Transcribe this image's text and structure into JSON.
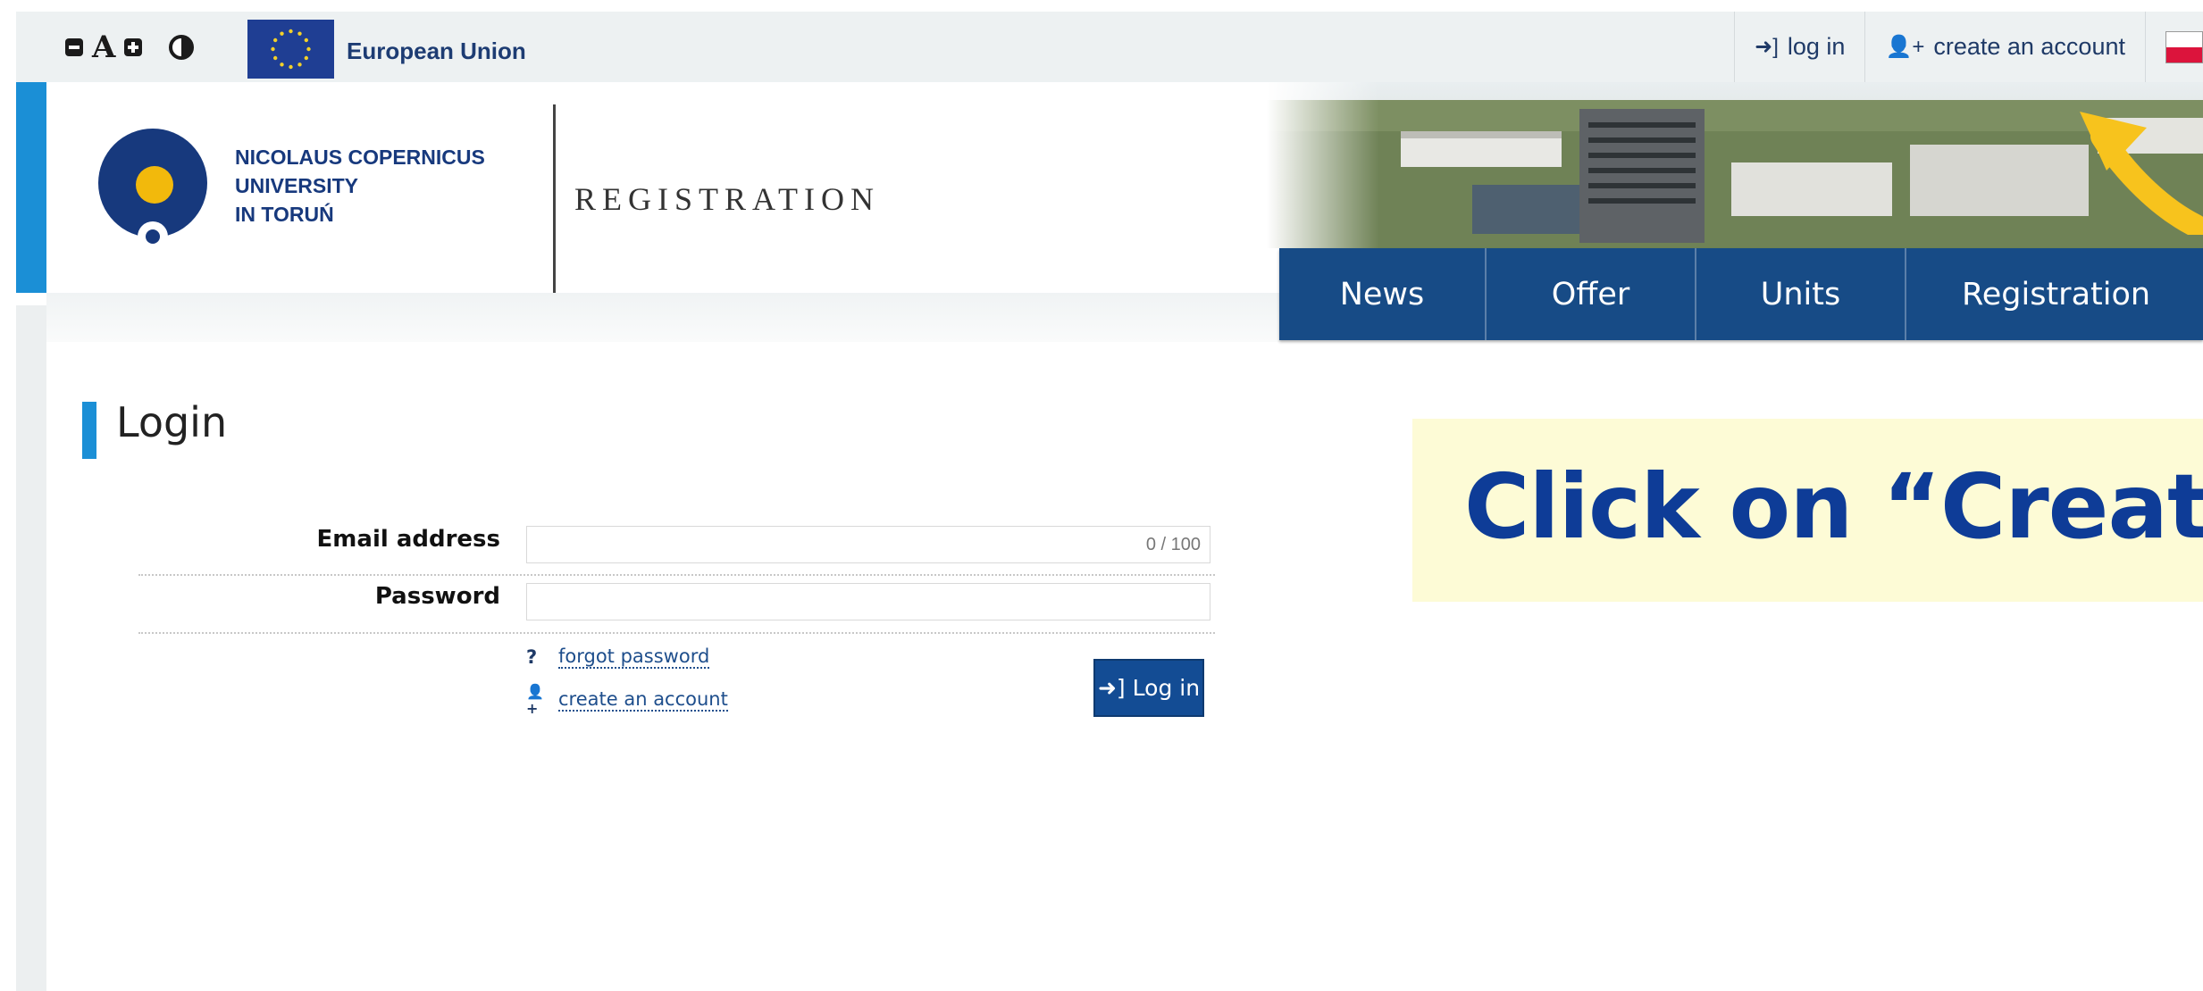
{
  "topbar": {
    "a11y": {
      "decrease_icon": "minus-square-icon",
      "font_letter": "A",
      "increase_icon": "plus-square-icon",
      "contrast_icon": "half-circle-icon"
    },
    "eu_label": "European Union",
    "links": {
      "login": "log in",
      "create_account": "create an account"
    },
    "language_flag": "polish-flag"
  },
  "header": {
    "university_lines": [
      "NICOLAUS COPERNICUS",
      "UNIVERSITY",
      "IN TORUŃ"
    ],
    "site_title": "REGISTRATION",
    "colors": {
      "navy": "#174b86",
      "accent": "#1b8fd6",
      "logo_yellow": "#f2b90c"
    }
  },
  "nav": {
    "items": [
      "News",
      "Offer",
      "Units",
      "Registration"
    ]
  },
  "login": {
    "title": "Login",
    "email_label": "Email address",
    "email_value": "",
    "email_counter": "0 / 100",
    "password_label": "Password",
    "password_value": "",
    "forgot_password": "forgot password",
    "create_account": "create an account",
    "submit": "Log in"
  },
  "callout": {
    "text": "Click on “Create",
    "background": "#fdfbd6",
    "color": "#0e3c97"
  },
  "annotation": {
    "arrow_color": "#f7c31d"
  }
}
